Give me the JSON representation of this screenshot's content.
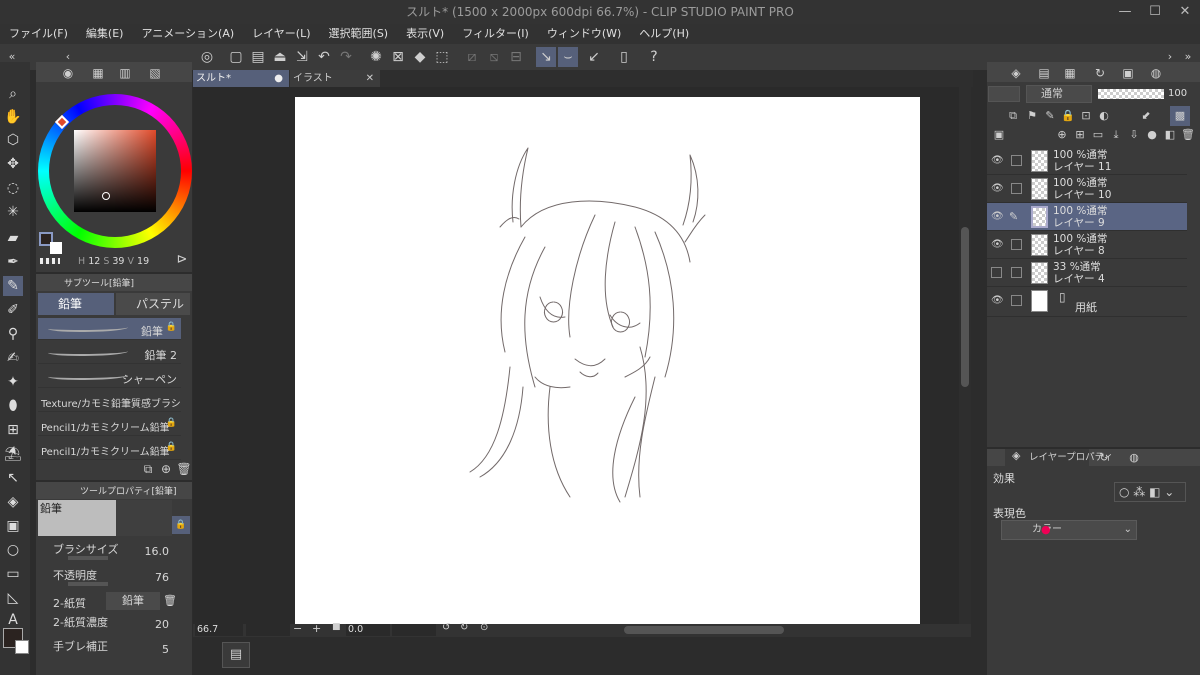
{
  "title": "スルト* (1500 x 2000px 600dpi 66.7%)  - CLIP STUDIO PAINT PRO",
  "menu": [
    "ファイル(F)",
    "編集(E)",
    "アニメーション(A)",
    "レイヤー(L)",
    "選択範囲(S)",
    "表示(V)",
    "フィルター(I)",
    "ウィンドウ(W)",
    "ヘルプ(H)"
  ],
  "tabs": [
    {
      "label": "スルト*"
    },
    {
      "label": "イラスト"
    }
  ],
  "color_hsv": {
    "h_label": "H",
    "h": "12",
    "s_label": "S",
    "s": "39",
    "v_label": "V",
    "v": "19"
  },
  "subtool": {
    "header": "サブツール[鉛筆]",
    "tabs": [
      "鉛筆",
      "パステル"
    ],
    "brushes": [
      "鉛筆",
      "鉛筆 2",
      "シャーペン",
      "Texture/カモミ鉛筆質感ブラシ",
      "Pencil1/カモミクリーム鉛筆",
      "Pencil1/カモミクリーム鉛筆"
    ]
  },
  "toolprop": {
    "header": "ツールプロパティ[鉛筆]",
    "preview_label": "鉛筆",
    "brush_size_label": "ブラシサイズ",
    "brush_size": "16.0",
    "opacity_label": "不透明度",
    "opacity": "76",
    "paper_label": "2-紙質",
    "paper_value": "鉛筆",
    "paper_density_label": "2-紙質濃度",
    "paper_density": "20",
    "stabilizer_label": "手ブレ補正",
    "stabilizer": "5"
  },
  "layers_panel": {
    "blend_mode": "通常",
    "opacity": "100",
    "layers": [
      {
        "line1": "100 %通常",
        "line2": "レイヤー 11",
        "visible": true,
        "selected": false
      },
      {
        "line1": "100 %通常",
        "line2": "レイヤー 10",
        "visible": true,
        "selected": false
      },
      {
        "line1": "100 %通常",
        "line2": "レイヤー 9",
        "visible": true,
        "selected": true
      },
      {
        "line1": "100 %通常",
        "line2": "レイヤー 8",
        "visible": true,
        "selected": false
      },
      {
        "line1": "33 %通常",
        "line2": "レイヤー 4",
        "visible": false,
        "selected": false
      },
      {
        "line1": "",
        "line2": "用紙",
        "visible": true,
        "selected": false
      }
    ]
  },
  "layer_props": {
    "tab": "レイヤープロパティ",
    "effect_label": "効果",
    "express_label": "表現色",
    "express_value": "カラー"
  },
  "statusbar": {
    "zoom": "66.7",
    "angle": "0.0"
  },
  "colors": {
    "accent": "#5a6584",
    "bg": "#2c2c2c",
    "panel": "#3a3a3a"
  }
}
